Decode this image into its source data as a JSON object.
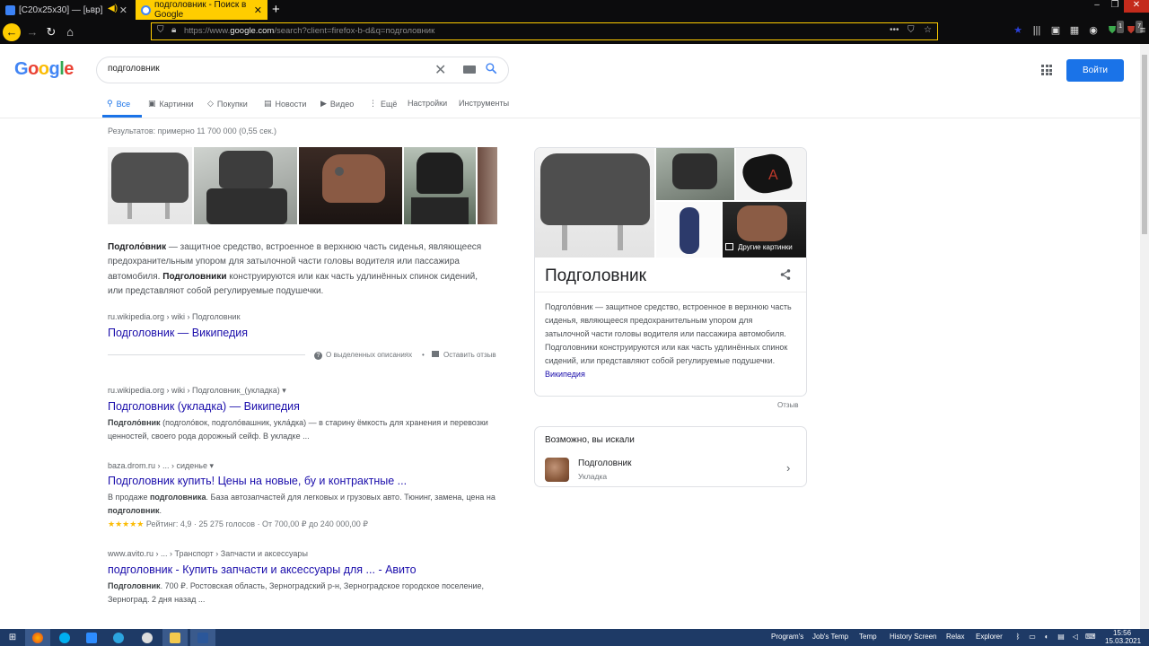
{
  "browser": {
    "tabs": [
      {
        "label": "[C20x25x30] — [ьвр]"
      },
      {
        "label": "подголовник - Поиск в Google"
      }
    ],
    "url": {
      "prefix": "https://www.",
      "host": "google.com",
      "rest": "/search?client=firefox-b-d&q=подголовник"
    },
    "badges": {
      "addon1": "1",
      "addon2": "7"
    }
  },
  "google": {
    "logo": "Google",
    "query": "подголовник",
    "signin_label": "Войти",
    "nav_tabs": [
      {
        "label": "Все",
        "icon": "search-icon"
      },
      {
        "label": "Картинки",
        "icon": "image-icon"
      },
      {
        "label": "Покупки",
        "icon": "tag-icon"
      },
      {
        "label": "Новости",
        "icon": "news-icon"
      },
      {
        "label": "Видео",
        "icon": "play-icon"
      },
      {
        "label": "Ещё",
        "icon": "more-vert-icon"
      },
      {
        "label": "Настройки"
      },
      {
        "label": "Инструменты"
      }
    ],
    "result_stats": "Результатов: примерно 11 700 000 (0,55 сек.)"
  },
  "featured": {
    "term": "Подголо́вник",
    "text1": " — защитное средство, встроенное в верхнюю часть сиденья, являющееся предохранительным упором для затылочной части головы водителя или пассажира автомобиля. ",
    "term2": "Подголовники",
    "text2": " конструируются или как часть удлинённых спинок сидений, или представляют собой регулируемые подушечки.",
    "cite": "ru.wikipedia.org › wiki › Подголовник",
    "title": "Подголовник — Википедия",
    "about_label": "О выделенных описаниях",
    "feedback_label": "Оставить отзыв"
  },
  "results": [
    {
      "cite": "ru.wikipedia.org › wiki › Подголовник_(укладка)",
      "title": "Подголовник (укладка) — Википедия",
      "bold": "Подголо́вник",
      "snippet": " (подголо́вок, подголо́вашник, укла́дка) — в старину ёмкость для хранения и перевозки ценностей, своего рода дорожный сейф. В укладке ..."
    },
    {
      "cite": "baza.drom.ru › ... › сиденье",
      "title": "Подголовник купить! Цены на новые, бу и контрактные ...",
      "s1": "В продаже ",
      "b1": "подголовника",
      "s2": ". База автозапчастей для легковых и грузовых авто. Тюнинг, замена, цена на ",
      "b2": "подголовник",
      "s3": ".",
      "stars": "★★★★★",
      "rating": " Рейтинг: 4,9 · 25 275 голосов · От 700,00 ₽ до 240 000,00 ₽"
    },
    {
      "cite": "www.avito.ru › ... › Транспорт › Запчасти и аксессуары",
      "title": "подголовник - Купить запчасти и аксессуары для ... - Авито",
      "bold": "Подголовник",
      "snippet": ". 700 ₽. Ростовская область, Зерноградский р-н, Зерноградское городское поселение, Зерноград. 2 дня назад ..."
    }
  ],
  "knowledge_panel": {
    "title": "Подголовник",
    "desc": "Подголо́вник — защитное средство, встроенное в верхнюю часть сиденья, являющееся предохранительным упором для затылочной части головы водителя или пассажира автомобиля. Подголовники конструируются или как часть удлинённых спинок сидений, или представляют собой регулируемые подушечки. ",
    "source": "Википедия",
    "more_images": "Другие картинки",
    "feedback": "Отзыв"
  },
  "people_also_search": {
    "title": "Возможно, вы искали",
    "name": "Подголовник",
    "sub": "Укладка"
  },
  "taskbar": {
    "toolbars": [
      "Program's",
      "Job's Temp",
      "Temp",
      "History Screen",
      "Relax",
      "Explorer"
    ],
    "time": "15:56",
    "date": "15.03.2021"
  }
}
